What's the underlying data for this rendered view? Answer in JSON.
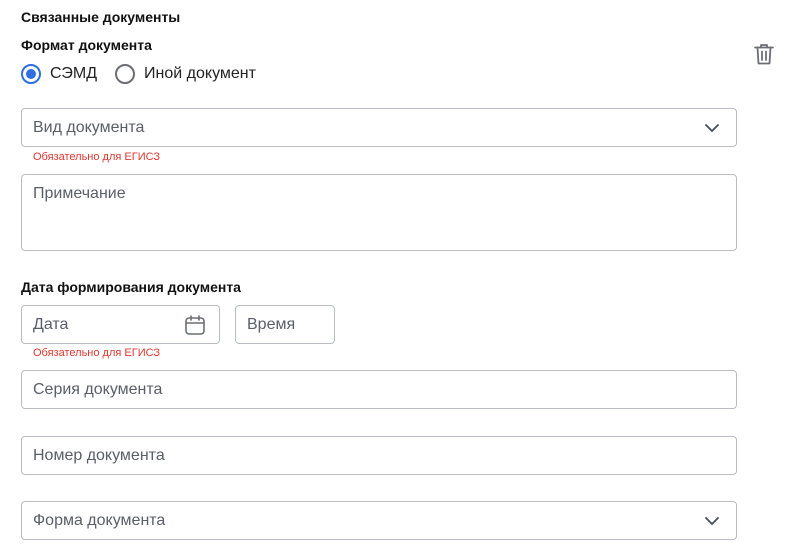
{
  "section_title": "Связанные документы",
  "format": {
    "label": "Формат документа",
    "options": [
      {
        "label": "СЭМД",
        "checked": true
      },
      {
        "label": "Иной документ",
        "checked": false
      }
    ]
  },
  "doc_type": {
    "placeholder": "Вид документа",
    "error": "Обязательно для ЕГИСЗ"
  },
  "note": {
    "placeholder": "Примечание"
  },
  "date_section": {
    "label": "Дата формирования документа"
  },
  "date": {
    "placeholder": "Дата",
    "error": "Обязательно для ЕГИСЗ"
  },
  "time": {
    "placeholder": "Время"
  },
  "series": {
    "placeholder": "Серия документа"
  },
  "number": {
    "placeholder": "Номер документа"
  },
  "form": {
    "placeholder": "Форма документа"
  },
  "icons": {
    "delete": "trash-icon",
    "calendar": "calendar-icon",
    "dropdown": "chevron-down-icon"
  },
  "colors": {
    "accent": "#2f6fe0",
    "error": "#e0372f",
    "border": "#b9bdc3"
  }
}
